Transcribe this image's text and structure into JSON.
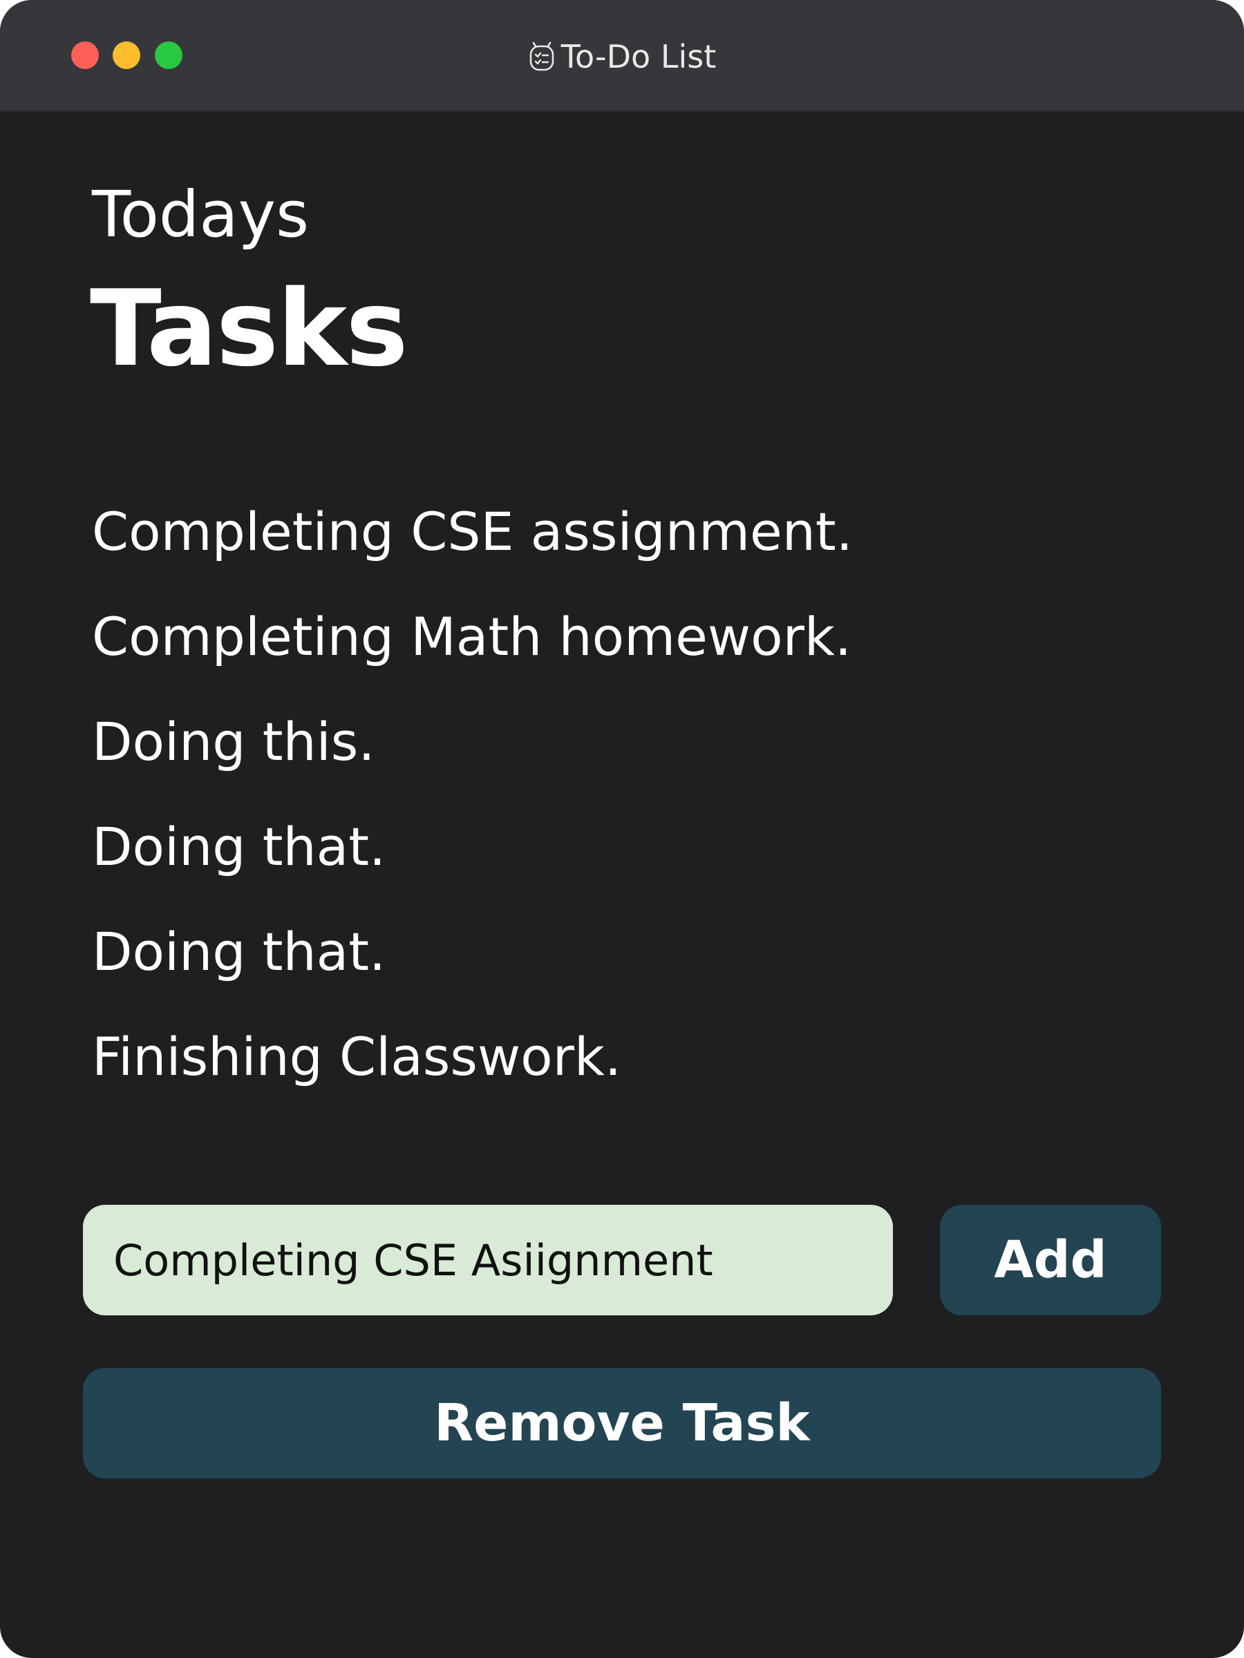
{
  "window": {
    "title": "To-Do List",
    "title_icon": "checklist-clock-icon",
    "controls": [
      "close",
      "minimize",
      "maximize"
    ],
    "colors": {
      "background": "#1e1f21",
      "titlebar": "#36373a",
      "close": "#fe5f57",
      "minimize": "#febc2e",
      "maximize": "#28c840"
    }
  },
  "header": {
    "line1": "Todays",
    "line2": "Tasks"
  },
  "tasks": [
    "Completing CSE assignment.",
    "Completing Math homework.",
    "Doing this.",
    "Doing that.",
    "Doing that.",
    "Finishing Classwork."
  ],
  "input": {
    "value": "Completing CSE Asiignment",
    "background": "#d9ead7"
  },
  "buttons": {
    "add_label": "Add",
    "remove_label": "Remove Task",
    "color": "#234452"
  }
}
